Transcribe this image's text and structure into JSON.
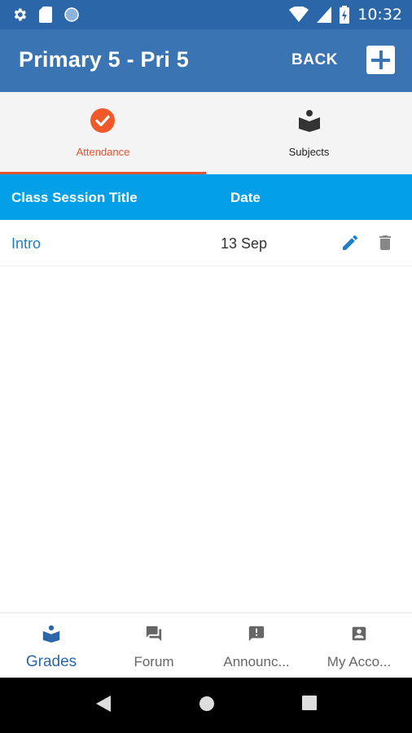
{
  "status_bar": {
    "time": "10:32",
    "icons": [
      "gear-icon",
      "sd-card-icon",
      "circle-icon",
      "wifi-icon",
      "signal-icon",
      "battery-charging-icon"
    ]
  },
  "app_bar": {
    "title": "Primary 5 - Pri 5",
    "back_label": "BACK",
    "add_icon": "plus-icon"
  },
  "tabs": [
    {
      "label": "Attendance",
      "icon": "check-circle-icon",
      "active": true
    },
    {
      "label": "Subjects",
      "icon": "book-reader-icon",
      "active": false
    }
  ],
  "table": {
    "headers": {
      "title": "Class Session Title",
      "date": "Date"
    },
    "rows": [
      {
        "title": "Intro",
        "date": "13 Sep"
      }
    ]
  },
  "bottom_nav": [
    {
      "label": "Grades",
      "icon": "book-reader-icon",
      "active": true
    },
    {
      "label": "Forum",
      "icon": "forum-icon",
      "active": false
    },
    {
      "label": "Announc...",
      "icon": "announcement-icon",
      "active": false
    },
    {
      "label": "My Acco...",
      "icon": "account-box-icon",
      "active": false
    }
  ],
  "colors": {
    "app_bar": "#3a74b3",
    "status_bar": "#2b66a8",
    "accent": "#e8522e",
    "table_header": "#03a0e8",
    "link": "#1e7fc8"
  }
}
